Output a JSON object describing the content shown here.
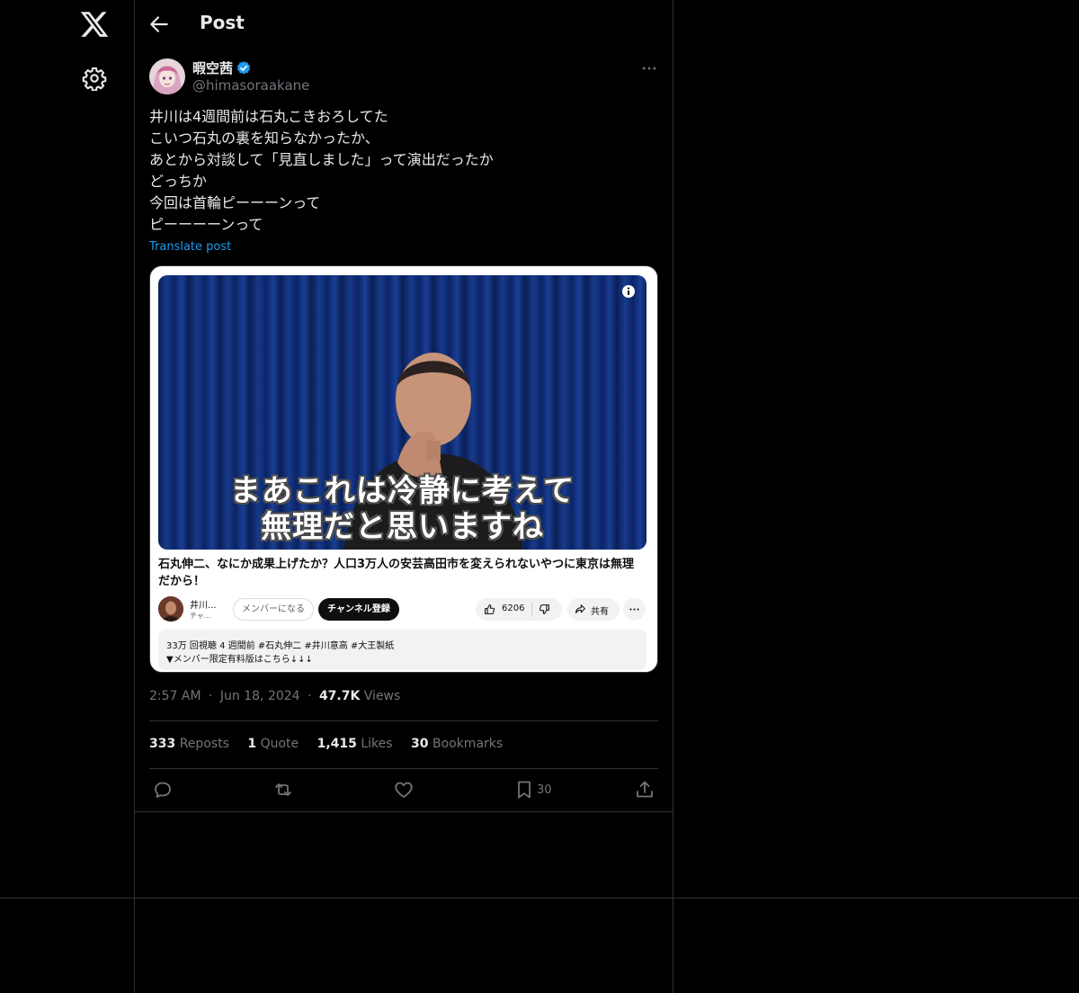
{
  "header": {
    "title": "Post"
  },
  "author": {
    "name": "暇空茜",
    "handle": "@himasoraakane"
  },
  "post": {
    "lines": [
      "井川は4週間前は石丸こきおろしてた",
      "こいつ石丸の裏を知らなかったか、",
      "あとから対談して「見直しました」って演出だったか",
      "どっちか",
      "今回は首輪ピーーーンって",
      "ピーーーーンって"
    ],
    "translate_label": "Translate post"
  },
  "card": {
    "caption_line1": "まあこれは冷静に考えて",
    "caption_line2": "無理だと思いますね",
    "video_title": "石丸伸二、なにか成果上げたか？人口3万人の安芸高田市を変えられないやつに東京は無理だから！",
    "channel_name": "井川...",
    "channel_sub": "チャ...",
    "member_label": "メンバーになる",
    "subscribe_label": "チャンネル登録",
    "like_count": "6206",
    "share_label": "共有",
    "desc_line1": "33万 回視聴  4 週間前  #石丸伸二 #井川意高 #大王製紙",
    "desc_line2": "▼メンバー限定有料版はこちら↓↓↓"
  },
  "meta": {
    "time": "2:57 AM",
    "sep": "·",
    "date": "Jun 18, 2024",
    "views_count": "47.7K",
    "views_label": "Views"
  },
  "stats": {
    "reposts_count": "333",
    "reposts_label": "Reposts",
    "quotes_count": "1",
    "quotes_label": "Quote",
    "likes_count": "1,415",
    "likes_label": "Likes",
    "bookmarks_count": "30",
    "bookmarks_label": "Bookmarks"
  },
  "actions": {
    "bookmark_count": "30"
  },
  "icons": {
    "logo": "x-logo-icon",
    "settings": "gear-icon",
    "back": "arrow-left-icon",
    "verified": "verified-badge-icon",
    "more": "more-horizontal-icon",
    "reply": "reply-icon",
    "repost": "repost-icon",
    "like": "heart-icon",
    "bookmark": "bookmark-icon",
    "share": "share-icon"
  },
  "colors": {
    "background": "#000000",
    "accent": "#1d9bf0",
    "text": "#e7e9ea",
    "muted": "#71767b",
    "border": "#2f3336"
  }
}
